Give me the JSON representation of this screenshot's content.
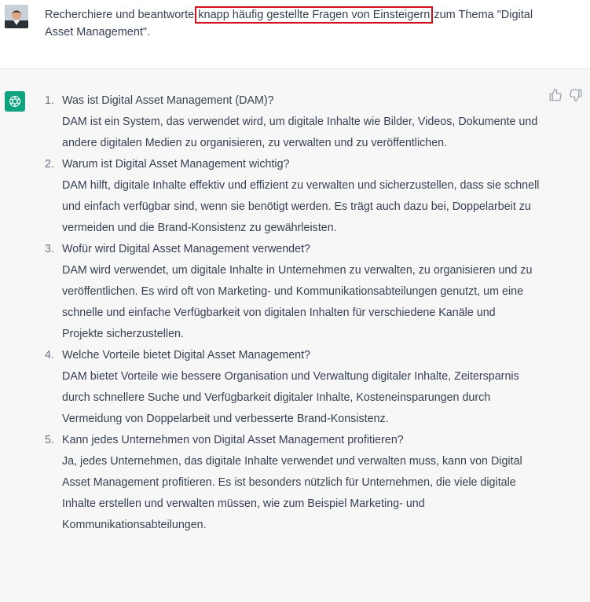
{
  "prompt": {
    "before": "Recherchiere und beantworte ",
    "highlight": "knapp häufig gestellte Fragen von Einsteigern",
    "after": " zum Thema \"Digital Asset Management\"."
  },
  "answer": {
    "items": [
      {
        "num": "1.",
        "q": "Was ist Digital Asset Management (DAM)?",
        "a": "DAM ist ein System, das verwendet wird, um digitale Inhalte wie Bilder, Videos, Dokumente und andere digitalen Medien zu organisieren, zu verwalten und zu veröffentlichen."
      },
      {
        "num": "2.",
        "q": "Warum ist Digital Asset Management wichtig?",
        "a": "DAM hilft, digitale Inhalte effektiv und effizient zu verwalten und sicherzustellen, dass sie schnell und einfach verfügbar sind, wenn sie benötigt werden. Es trägt auch dazu bei, Doppelarbeit zu vermeiden und die Brand-Konsistenz zu gewährleisten."
      },
      {
        "num": "3.",
        "q": "Wofür wird Digital Asset Management verwendet?",
        "a": "DAM wird verwendet, um digitale Inhalte in Unternehmen zu verwalten, zu organisieren und zu veröffentlichen. Es wird oft von Marketing- und Kommunikationsabteilungen genutzt, um eine schnelle und einfache Verfügbarkeit von digitalen Inhalten für verschiedene Kanäle und Projekte sicherzustellen."
      },
      {
        "num": "4.",
        "q": "Welche Vorteile bietet Digital Asset Management?",
        "a": "DAM bietet Vorteile wie bessere Organisation und Verwaltung digitaler Inhalte, Zeitersparnis durch schnellere Suche und Verfügbarkeit digitaler Inhalte, Kosteneinsparungen durch Vermeidung von Doppelarbeit und verbesserte Brand-Konsistenz."
      },
      {
        "num": "5.",
        "q": "Kann jedes Unternehmen von Digital Asset Management profitieren?",
        "a": "Ja, jedes Unternehmen, das digitale Inhalte verwendet und verwalten muss, kann von Digital Asset Management profitieren. Es ist besonders nützlich für Unternehmen, die viele digitale Inhalte erstellen und verwalten müssen, wie zum Beispiel Marketing- und Kommunikationsabteilungen."
      }
    ]
  },
  "colors": {
    "highlight_border": "#d4111b",
    "assistant_icon_bg": "#10a37f"
  },
  "icons": {
    "user": "user-avatar",
    "assistant": "openai-logo-icon",
    "like": "thumbs-up-icon",
    "dislike": "thumbs-down-icon"
  }
}
